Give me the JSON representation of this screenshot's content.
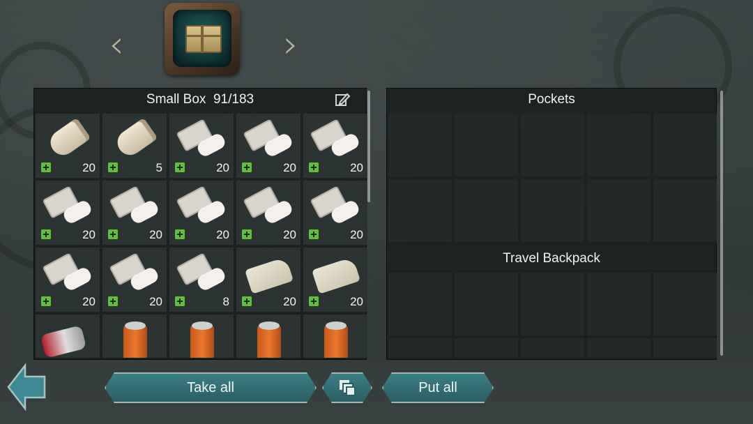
{
  "left_panel": {
    "title": "Small Box  91/183",
    "items": [
      {
        "kind": "roll",
        "count": "20",
        "medical": true
      },
      {
        "kind": "roll",
        "count": "5",
        "medical": true
      },
      {
        "kind": "pack",
        "count": "20",
        "medical": true
      },
      {
        "kind": "pack",
        "count": "20",
        "medical": true
      },
      {
        "kind": "pack",
        "count": "20",
        "medical": true
      },
      {
        "kind": "pack",
        "count": "20",
        "medical": true
      },
      {
        "kind": "pack",
        "count": "20",
        "medical": true
      },
      {
        "kind": "pack",
        "count": "20",
        "medical": true
      },
      {
        "kind": "pack",
        "count": "20",
        "medical": true
      },
      {
        "kind": "pack",
        "count": "20",
        "medical": true
      },
      {
        "kind": "pack",
        "count": "20",
        "medical": true
      },
      {
        "kind": "pack",
        "count": "20",
        "medical": true
      },
      {
        "kind": "pack",
        "count": "8",
        "medical": true
      },
      {
        "kind": "cloth",
        "count": "20",
        "medical": true
      },
      {
        "kind": "cloth",
        "count": "20",
        "medical": true
      },
      {
        "kind": "kit",
        "count": "",
        "medical": false
      },
      {
        "kind": "canister",
        "count": "",
        "medical": false
      },
      {
        "kind": "canister",
        "count": "",
        "medical": false
      },
      {
        "kind": "canister",
        "count": "",
        "medical": false
      },
      {
        "kind": "canister",
        "count": "",
        "medical": false
      }
    ]
  },
  "right_panel": {
    "pockets_title": "Pockets",
    "backpack_title": "Travel Backpack"
  },
  "buttons": {
    "take_all": "Take all",
    "put_all": "Put all"
  },
  "icons": {
    "prev": "chevron-left-icon",
    "next": "chevron-right-icon",
    "container": "crate-icon",
    "edit": "pencil-icon",
    "stack": "stack-icon",
    "back": "back-arrow-icon",
    "medical": "medical-cross-icon"
  },
  "colors": {
    "accent_button": "#2f6a70",
    "medical_badge": "#5fc13a"
  }
}
